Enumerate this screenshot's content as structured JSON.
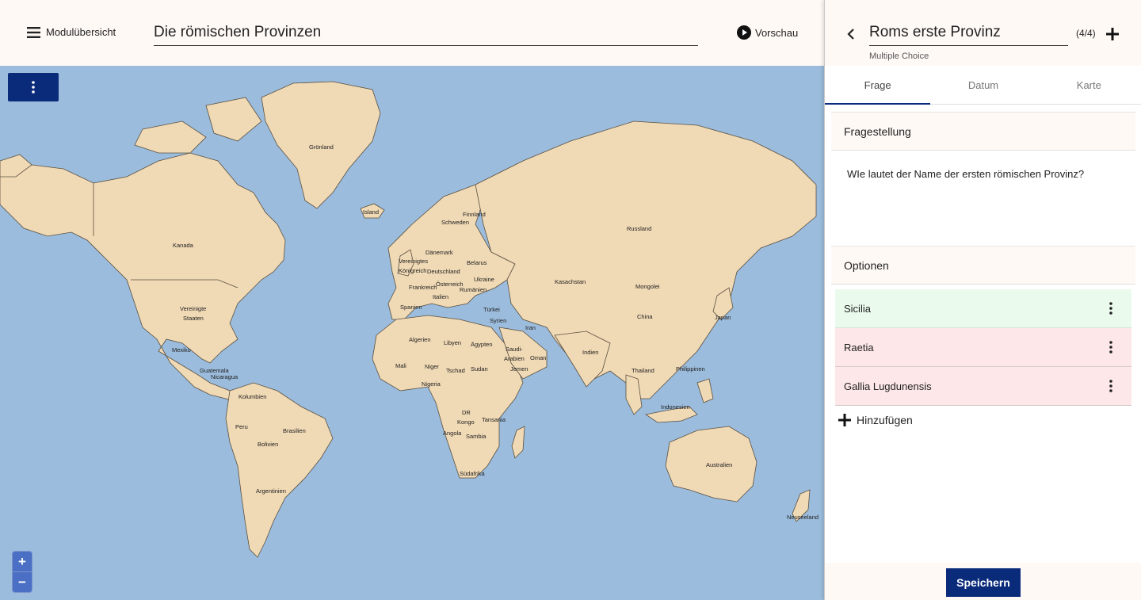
{
  "header": {
    "menu_label": "Modulübersicht",
    "module_title": "Die römischen Provinzen",
    "preview_label": "Vorschau"
  },
  "map": {
    "zoom_in": "+",
    "zoom_out": "−",
    "labels": {
      "groenland": "Grönland",
      "island": "Island",
      "kanada": "Kanada",
      "usa_1": "Vereinigte",
      "usa_2": "Staaten",
      "mexiko": "Mexiko",
      "guatemala": "Guatemala",
      "nicaragua": "Nicaragua",
      "kolumbien": "Kolumbien",
      "peru": "Peru",
      "brasilien": "Brasilien",
      "bolivien": "Bolivien",
      "argentinien": "Argentinien",
      "finnland": "Finnland",
      "schweden": "Schweden",
      "daenemark": "Dänemark",
      "uk_1": "Vereinigtes",
      "uk_2": "Königreich",
      "deutschland": "Deutschland",
      "belarus": "Belarus",
      "frankreich": "Frankreich",
      "oesterreich": "Österreich",
      "ukraine": "Ukraine",
      "rumaenien": "Rumänien",
      "italien": "Italien",
      "spanien": "Spanien",
      "tuerkei": "Türkei",
      "syrien": "Syrien",
      "russland": "Russland",
      "kasachstan": "Kasachstan",
      "mongolei": "Mongolei",
      "china": "China",
      "japan": "Japan",
      "iran": "Iran",
      "algerien": "Algerien",
      "libyen": "Libyen",
      "aegypten": "Ägypten",
      "saudi_1": "Saudi-",
      "saudi_2": "Arabien",
      "oman": "Oman",
      "jemen": "Jemen",
      "mali": "Mali",
      "niger": "Niger",
      "tschad": "Tschad",
      "sudan": "Sudan",
      "nigeria": "Nigeria",
      "drk_1": "DR",
      "drk_2": "Kongo",
      "tansania": "Tansania",
      "angola": "Angola",
      "sambia": "Sambia",
      "suedafrika": "Südafrika",
      "indien": "Indien",
      "thailand": "Thailand",
      "philippinen": "Philippinen",
      "indonesien": "Indonesien",
      "australien": "Australien",
      "neuseeland": "Neuseeland"
    }
  },
  "panel": {
    "question_title": "Roms erste Provinz",
    "position": "(4/4)",
    "question_type": "Multiple Choice",
    "tabs": [
      "Frage",
      "Datum",
      "Karte"
    ],
    "question_section": "Fragestellung",
    "question_text": "WIe lautet der Name der ersten römischen Provinz?",
    "options_section": "Optionen",
    "options": [
      {
        "label": "Sicilia",
        "status": "correct"
      },
      {
        "label": "Raetia",
        "status": "wrong"
      },
      {
        "label": "Gallia Lugdunensis",
        "status": "wrong"
      }
    ],
    "add_label": "Hinzufügen",
    "save_label": "Speichern"
  },
  "colors": {
    "accent": "#0a2a7a",
    "ocean": "#9bbcdc",
    "land": "#f0d9b5",
    "correct_bg": "#eafbee",
    "wrong_bg": "#fde7e8",
    "header_bg": "#fff9f6"
  },
  "icons": {
    "menu": "hamburger-icon",
    "preview": "play-circle-icon",
    "back": "chevron-left-icon",
    "add": "plus-icon",
    "more": "vertical-dots-icon"
  }
}
